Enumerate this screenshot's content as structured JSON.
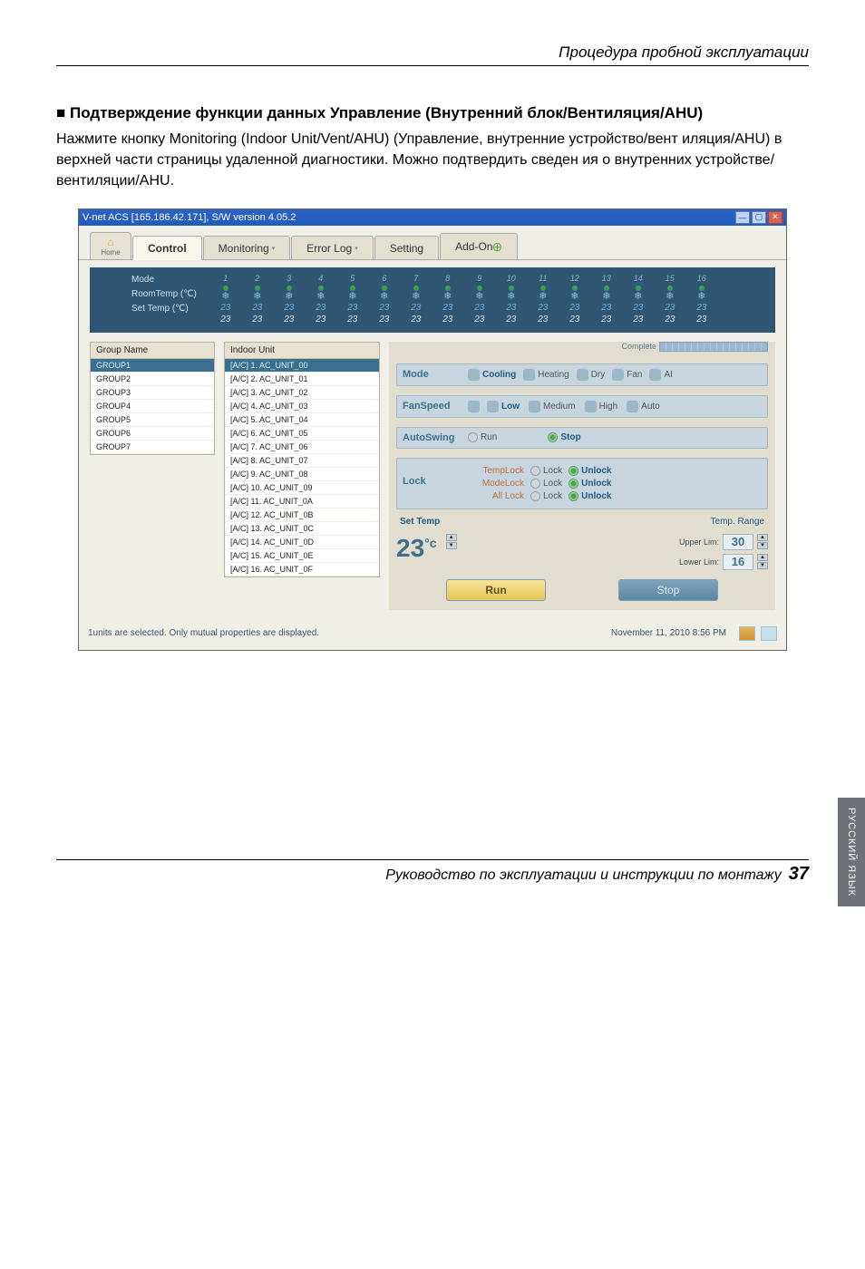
{
  "header": {
    "running_title": "Процедура пробной эксплуатации"
  },
  "section": {
    "bullet": "■",
    "title": "Подтверждение функции данных Управление (Внутренний блок/Вентиляция/AHU)",
    "body": "Нажмите кнопку Monitoring (Indoor Unit/Vent/AHU) (Управление, внутренние устройство/вент иляция/AHU) в верхней части страницы удаленной диагностики. Можно подтвердить сведен ия о внутренних устройстве/вентиляции/AHU."
  },
  "side_tab": "РУССКИЙ ЯЗЫК",
  "footer": {
    "caption": "Руководство по эксплуатации и инструкции по монтажу",
    "page": "37"
  },
  "app": {
    "title": "V-net ACS [165.186.42.171],   S/W version 4.05.2",
    "tabs": {
      "home": "Home",
      "control": "Control",
      "monitoring": "Monitoring",
      "errorlog": "Error Log",
      "setting": "Setting",
      "addon": "Add-On"
    },
    "status": {
      "labels": {
        "mode": "Mode",
        "roomtemp": "RoomTemp (℃)",
        "settemp": "Set Temp   (℃)"
      },
      "cols": [
        {
          "i": "1",
          "v1": "23",
          "v2": "23"
        },
        {
          "i": "2",
          "v1": "23",
          "v2": "23"
        },
        {
          "i": "3",
          "v1": "23",
          "v2": "23"
        },
        {
          "i": "4",
          "v1": "23",
          "v2": "23"
        },
        {
          "i": "5",
          "v1": "23",
          "v2": "23"
        },
        {
          "i": "6",
          "v1": "23",
          "v2": "23"
        },
        {
          "i": "7",
          "v1": "23",
          "v2": "23"
        },
        {
          "i": "8",
          "v1": "23",
          "v2": "23"
        },
        {
          "i": "9",
          "v1": "23",
          "v2": "23"
        },
        {
          "i": "10",
          "v1": "23",
          "v2": "23"
        },
        {
          "i": "11",
          "v1": "23",
          "v2": "23"
        },
        {
          "i": "12",
          "v1": "23",
          "v2": "23"
        },
        {
          "i": "13",
          "v1": "23",
          "v2": "23"
        },
        {
          "i": "14",
          "v1": "23",
          "v2": "23"
        },
        {
          "i": "15",
          "v1": "23",
          "v2": "23"
        },
        {
          "i": "16",
          "v1": "23",
          "v2": "23"
        }
      ]
    },
    "group": {
      "header": "Group Name",
      "items": [
        "GROUP1",
        "GROUP2",
        "GROUP3",
        "GROUP4",
        "GROUP5",
        "GROUP6",
        "GROUP7"
      ],
      "selected": 0
    },
    "units": {
      "header": "Indoor Unit",
      "items": [
        "[A/C]  1. AC_UNIT_00",
        "[A/C]  2. AC_UNIT_01",
        "[A/C]  3. AC_UNIT_02",
        "[A/C]  4. AC_UNIT_03",
        "[A/C]  5. AC_UNIT_04",
        "[A/C]  6. AC_UNIT_05",
        "[A/C]  7. AC_UNIT_06",
        "[A/C]  8. AC_UNIT_07",
        "[A/C]  9. AC_UNIT_08",
        "[A/C]  10. AC_UNIT_09",
        "[A/C]  11. AC_UNIT_0A",
        "[A/C]  12. AC_UNIT_0B",
        "[A/C]  13. AC_UNIT_0C",
        "[A/C]  14. AC_UNIT_0D",
        "[A/C]  15. AC_UNIT_0E",
        "[A/C]  16. AC_UNIT_0F"
      ],
      "selected": 0
    },
    "right": {
      "complete": "Complete",
      "mode": {
        "label": "Mode",
        "opts": [
          "Cooling",
          "Heating",
          "Dry",
          "Fan",
          "AI"
        ],
        "sel": 0
      },
      "fan": {
        "label": "FanSpeed",
        "opts": [
          "Low",
          "Medium",
          "High",
          "Auto"
        ],
        "sel": 0
      },
      "swing": {
        "label": "AutoSwing",
        "run": "Run",
        "stop": "Stop",
        "sel": "stop"
      },
      "lock": {
        "label": "Lock",
        "rows": [
          {
            "name": "TempLock",
            "lock": "Lock",
            "unlock": "Unlock"
          },
          {
            "name": "ModeLock",
            "lock": "Lock",
            "unlock": "Unlock"
          },
          {
            "name": "All Lock",
            "lock": "Lock",
            "unlock": "Unlock"
          }
        ]
      },
      "settemp": {
        "label": "Set Temp",
        "range": "Temp. Range",
        "value": "23",
        "unit": "°c",
        "upper": "Upper Lim:",
        "upperv": "30",
        "lower": "Lower Lim:",
        "lowerv": "16"
      },
      "run": "Run",
      "stop": "Stop"
    },
    "footer": {
      "msg": "1units are selected. Only mutual properties are displayed.",
      "datetime": "November 11, 2010  8:56 PM"
    }
  }
}
